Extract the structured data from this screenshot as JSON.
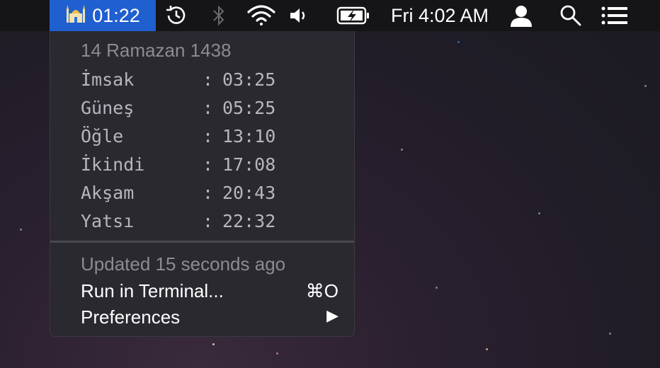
{
  "menubar": {
    "app_time": "01:22",
    "clock": "Fri 4:02 AM",
    "icons": [
      "mosque-icon",
      "time-machine-icon",
      "bluetooth-icon",
      "wifi-icon",
      "volume-icon",
      "battery-charging-icon",
      "user-icon",
      "spotlight-search-icon",
      "notification-center-icon"
    ]
  },
  "menu": {
    "date": "14 Ramazan 1438",
    "prayers": [
      {
        "name": "İmsak",
        "time": "03:25"
      },
      {
        "name": "Güneş",
        "time": "05:25"
      },
      {
        "name": "Öğle",
        "time": "13:10"
      },
      {
        "name": "İkindi",
        "time": "17:08"
      },
      {
        "name": "Akşam",
        "time": "20:43"
      },
      {
        "name": "Yatsı",
        "time": "22:32"
      }
    ],
    "updated": "Updated 15 seconds ago",
    "run_label": "Run in Terminal...",
    "run_shortcut": "⌘O",
    "prefs_label": "Preferences",
    "prefs_arrow": "▶"
  }
}
